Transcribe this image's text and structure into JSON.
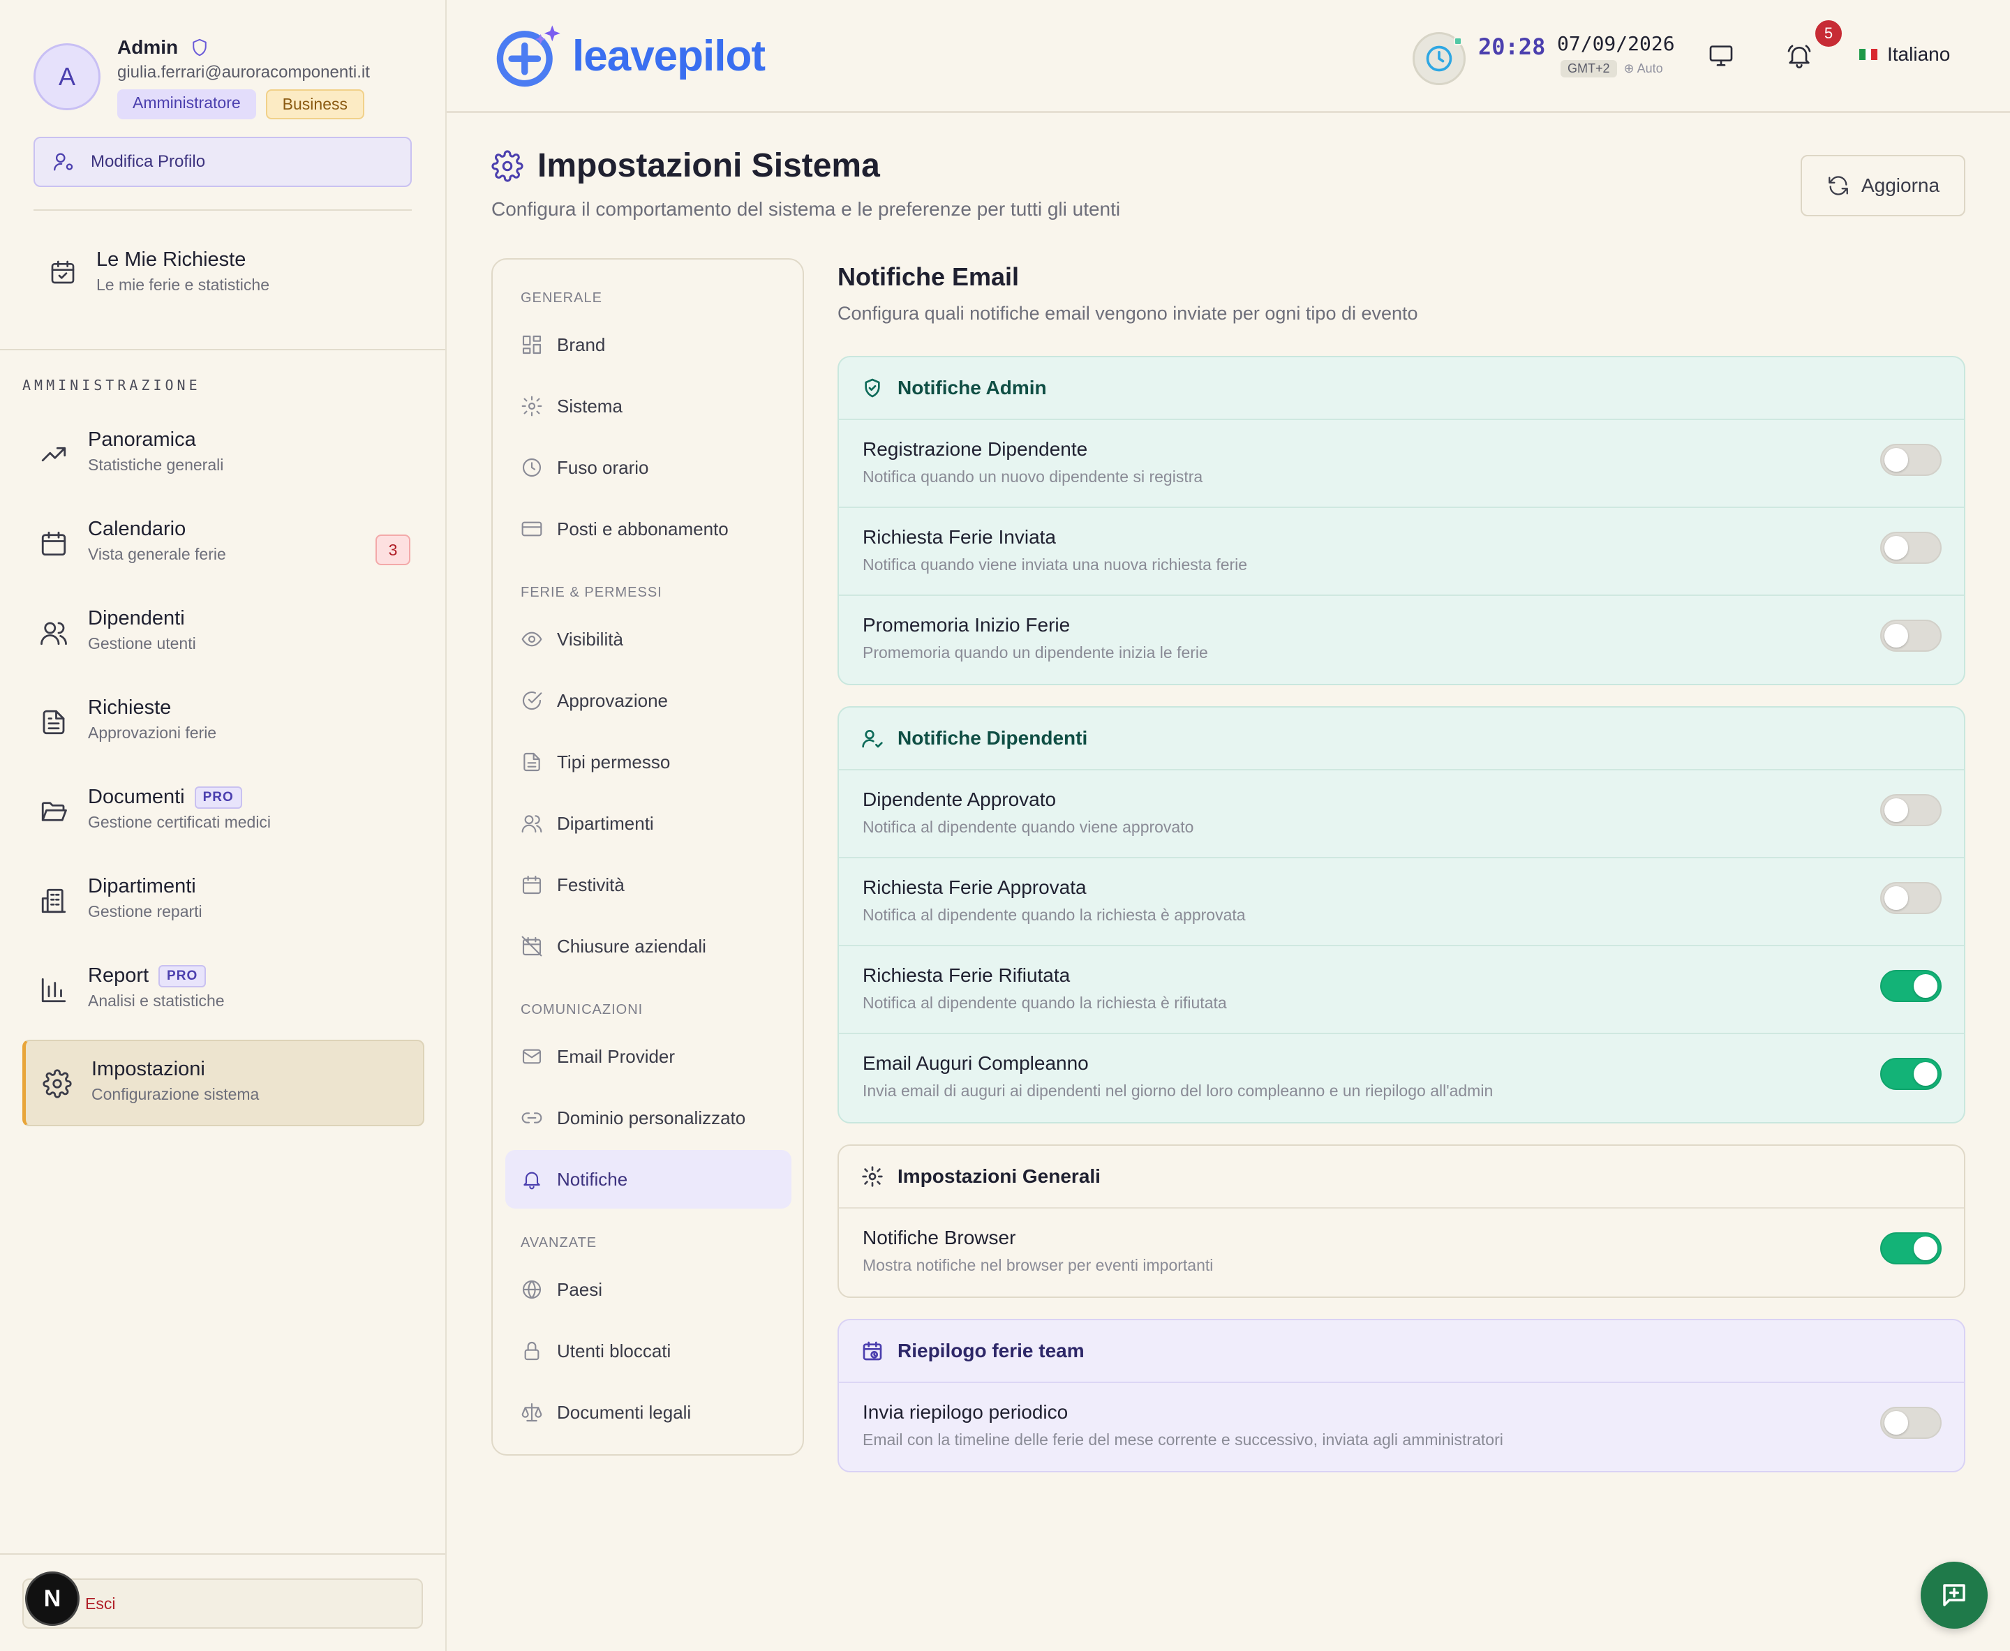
{
  "profile": {
    "avatar_letter": "A",
    "name": "Admin",
    "email": "giulia.ferrari@auroracomponenti.it",
    "role_badge": "Amministratore",
    "plan_badge": "Business",
    "edit_label": "Modifica Profilo"
  },
  "my_requests": {
    "title": "Le Mie Richieste",
    "subtitle": "Le mie ferie e statistiche"
  },
  "admin_section": "AMMINISTRAZIONE",
  "nav": [
    {
      "title": "Panoramica",
      "subtitle": "Statistiche generali",
      "icon": "trending-up-icon"
    },
    {
      "title": "Calendario",
      "subtitle": "Vista generale ferie",
      "icon": "calendar-icon",
      "count": "3"
    },
    {
      "title": "Dipendenti",
      "subtitle": "Gestione utenti",
      "icon": "users-icon"
    },
    {
      "title": "Richieste",
      "subtitle": "Approvazioni ferie",
      "icon": "file-text-icon"
    },
    {
      "title": "Documenti",
      "subtitle": "Gestione certificati medici",
      "icon": "folder-icon",
      "pro": "PRO"
    },
    {
      "title": "Dipartimenti",
      "subtitle": "Gestione reparti",
      "icon": "building-icon"
    },
    {
      "title": "Report",
      "subtitle": "Analisi e statistiche",
      "icon": "bar-chart-icon",
      "pro": "PRO"
    },
    {
      "title": "Impostazioni",
      "subtitle": "Configurazione sistema",
      "icon": "gear-icon",
      "active": true
    }
  ],
  "logout_label": "Esci",
  "next_badge": "N",
  "header": {
    "logo_text": "leavepilot",
    "time": "20:28",
    "date": "07/09/2026",
    "timezone": "GMT+2",
    "tz_mode": "⊕ Auto",
    "notifications_count": "5",
    "language": "Italiano"
  },
  "page": {
    "title": "Impostazioni Sistema",
    "subtitle": "Configura il comportamento del sistema e le preferenze per tutti gli utenti",
    "refresh_label": "Aggiorna"
  },
  "settings_nav": {
    "sections": [
      {
        "label": "GENERALE",
        "items": [
          "Brand",
          "Sistema",
          "Fuso orario",
          "Posti e abbonamento"
        ]
      },
      {
        "label": "FERIE & PERMESSI",
        "items": [
          "Visibilità",
          "Approvazione",
          "Tipi permesso",
          "Dipartimenti",
          "Festività",
          "Chiusure aziendali"
        ]
      },
      {
        "label": "COMUNICAZIONI",
        "items": [
          "Email Provider",
          "Dominio personalizzato",
          "Notifiche"
        ]
      },
      {
        "label": "AVANZATE",
        "items": [
          "Paesi",
          "Utenti bloccati",
          "Documenti legali"
        ]
      }
    ],
    "active": "Notifiche"
  },
  "content": {
    "title": "Notifiche Email",
    "subtitle": "Configura quali notifiche email vengono inviate per ogni tipo di evento",
    "cards": [
      {
        "title": "Notifiche Admin",
        "rows": [
          {
            "title": "Registrazione Dipendente",
            "subtitle": "Notifica quando un nuovo dipendente si registra",
            "on": false
          },
          {
            "title": "Richiesta Ferie Inviata",
            "subtitle": "Notifica quando viene inviata una nuova richiesta ferie",
            "on": false
          },
          {
            "title": "Promemoria Inizio Ferie",
            "subtitle": "Promemoria quando un dipendente inizia le ferie",
            "on": false
          }
        ]
      },
      {
        "title": "Notifiche Dipendenti",
        "rows": [
          {
            "title": "Dipendente Approvato",
            "subtitle": "Notifica al dipendente quando viene approvato",
            "on": false
          },
          {
            "title": "Richiesta Ferie Approvata",
            "subtitle": "Notifica al dipendente quando la richiesta è approvata",
            "on": false
          },
          {
            "title": "Richiesta Ferie Rifiutata",
            "subtitle": "Notifica al dipendente quando la richiesta è rifiutata",
            "on": true
          },
          {
            "title": "Email Auguri Compleanno",
            "subtitle": "Invia email di auguri ai dipendenti nel giorno del loro compleanno e un riepilogo all'admin",
            "on": true
          }
        ]
      },
      {
        "title": "Impostazioni Generali",
        "rows": [
          {
            "title": "Notifiche Browser",
            "subtitle": "Mostra notifiche nel browser per eventi importanti",
            "on": true
          }
        ]
      },
      {
        "title": "Riepilogo ferie team",
        "rows": [
          {
            "title": "Invia riepilogo periodico",
            "subtitle": "Email con la timeline delle ferie del mese corrente e successivo, inviata agli amministratori",
            "on": false
          }
        ]
      }
    ]
  },
  "colors": {
    "accent": "#4b3fae",
    "toggle_on": "#13b377",
    "active_border": "#e8a53a",
    "logo_blue": "#3a6ff0"
  }
}
